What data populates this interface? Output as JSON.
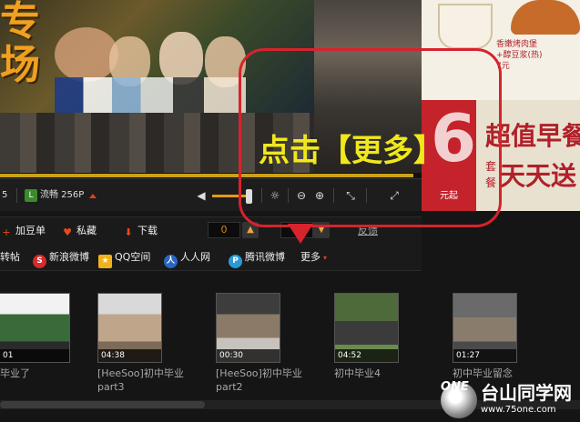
{
  "video": {
    "promo_text_line1": "专",
    "promo_text_line2": "场",
    "progress": 0.98
  },
  "ad": {
    "item1": "香嫩烤肉堡",
    "item2": "+醇豆浆(热)",
    "price": "7元",
    "big_number": "6",
    "unit": "元起",
    "headline1": "超值早餐",
    "headline2": "天天送",
    "sub1": "套",
    "sub2": "餐"
  },
  "controls": {
    "left_text": "5",
    "quality_icon": "L",
    "quality_label": "流畅 256P",
    "volume_level": 0.9,
    "icons": [
      "speaker-icon",
      "brightness-icon",
      "zoom-out-icon",
      "zoom-in-icon",
      "fullscreen-icon",
      "expand-icon"
    ]
  },
  "actions": {
    "add_playlist": "加豆单",
    "favorite": "私藏",
    "download": "下载",
    "like_count": "0",
    "dislike_count": "0",
    "report": "反馈"
  },
  "share": {
    "repost": "转帖",
    "sina": "新浪微博",
    "qzone": "QQ空间",
    "renren": "人人网",
    "tencent": "腾讯微博",
    "more": "更多"
  },
  "annotation": {
    "text": "点击【更多】"
  },
  "thumbnails": [
    {
      "duration": "01",
      "caption": "毕业了"
    },
    {
      "duration": "04:38",
      "caption": "[HeeSoo]初中毕业 part3"
    },
    {
      "duration": "00:30",
      "caption": "[HeeSoo]初中毕业 part2"
    },
    {
      "duration": "04:52",
      "caption": "初中毕业4"
    },
    {
      "duration": "01:27",
      "caption": "初中毕业留念"
    }
  ],
  "watermark": {
    "logo": "ONE",
    "site": "台山同学网",
    "url": "www.75one.com"
  },
  "colors": {
    "accent_orange": "#e49a1a",
    "annotation_red": "#d7232c",
    "annotation_text": "#f0e81c"
  }
}
